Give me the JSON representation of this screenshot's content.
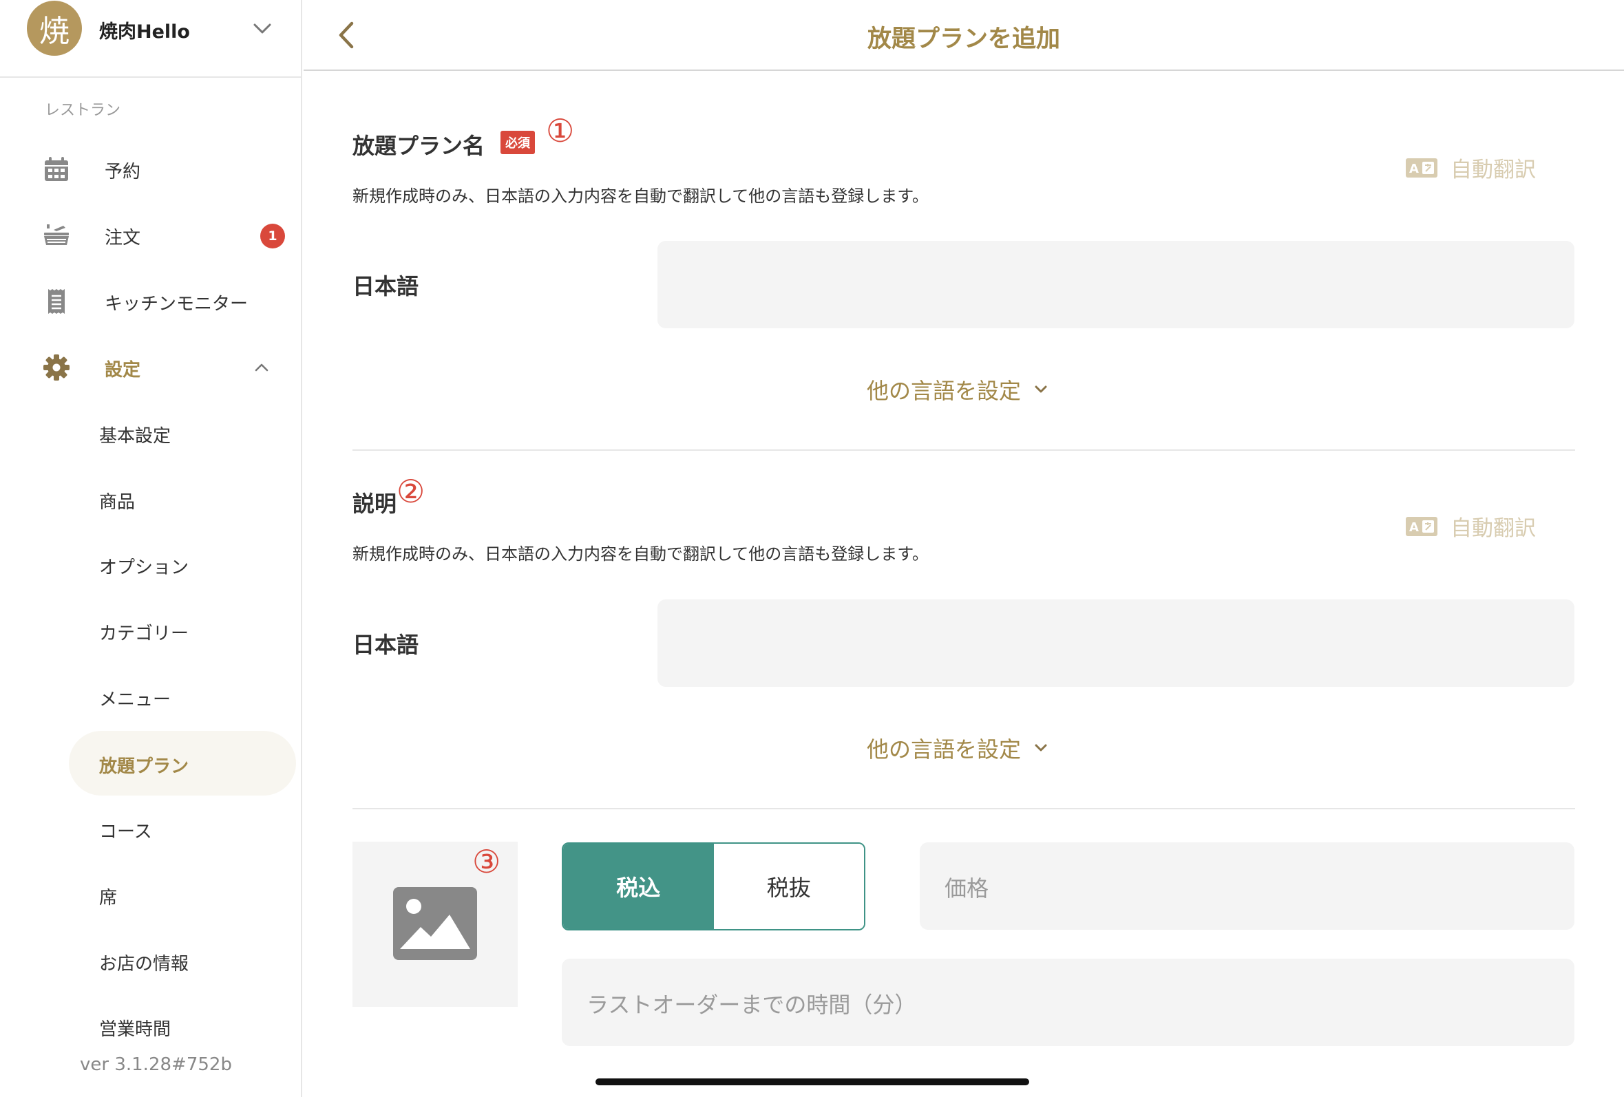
{
  "sidebar": {
    "avatar_text": "焼",
    "restaurant_name": "焼肉Hello",
    "section_label": "レストラン",
    "nav": [
      {
        "label": "予約",
        "icon": "calendar-icon"
      },
      {
        "label": "注文",
        "icon": "order-tray-icon",
        "badge": "1"
      },
      {
        "label": "キッチンモニター",
        "icon": "receipt-icon"
      },
      {
        "label": "設定",
        "icon": "gear-icon"
      }
    ],
    "settings_items": [
      "基本設定",
      "商品",
      "オプション",
      "カテゴリー",
      "メニュー",
      "放題プラン",
      "コース",
      "席",
      "お店の情報",
      "営業時間"
    ],
    "active_item": "放題プラン",
    "version": "ver 3.1.28#752b"
  },
  "header": {
    "title": "放題プランを追加"
  },
  "form": {
    "name_section": {
      "title": "放題プラン名",
      "required": "必須",
      "marker": "①",
      "description": "新規作成時のみ、日本語の入力内容を自動で翻訳して他の言語も登録します。",
      "auto_translate": "自動翻訳",
      "language_label": "日本語",
      "more_languages": "他の言語を設定"
    },
    "description_section": {
      "title": "説明",
      "marker": "②",
      "description": "新規作成時のみ、日本語の入力内容を自動で翻訳して他の言語も登録します。",
      "auto_translate": "自動翻訳",
      "language_label": "日本語",
      "more_languages": "他の言語を設定"
    },
    "image_marker": "③",
    "tax": {
      "selected": "税込",
      "other": "税抜"
    },
    "price_placeholder": "価格",
    "last_order_placeholder": "ラストオーダーまでの時間（分）"
  },
  "colors": {
    "accent_gold": "#a28848",
    "teal": "#439487",
    "badge_red": "#d9483b"
  }
}
